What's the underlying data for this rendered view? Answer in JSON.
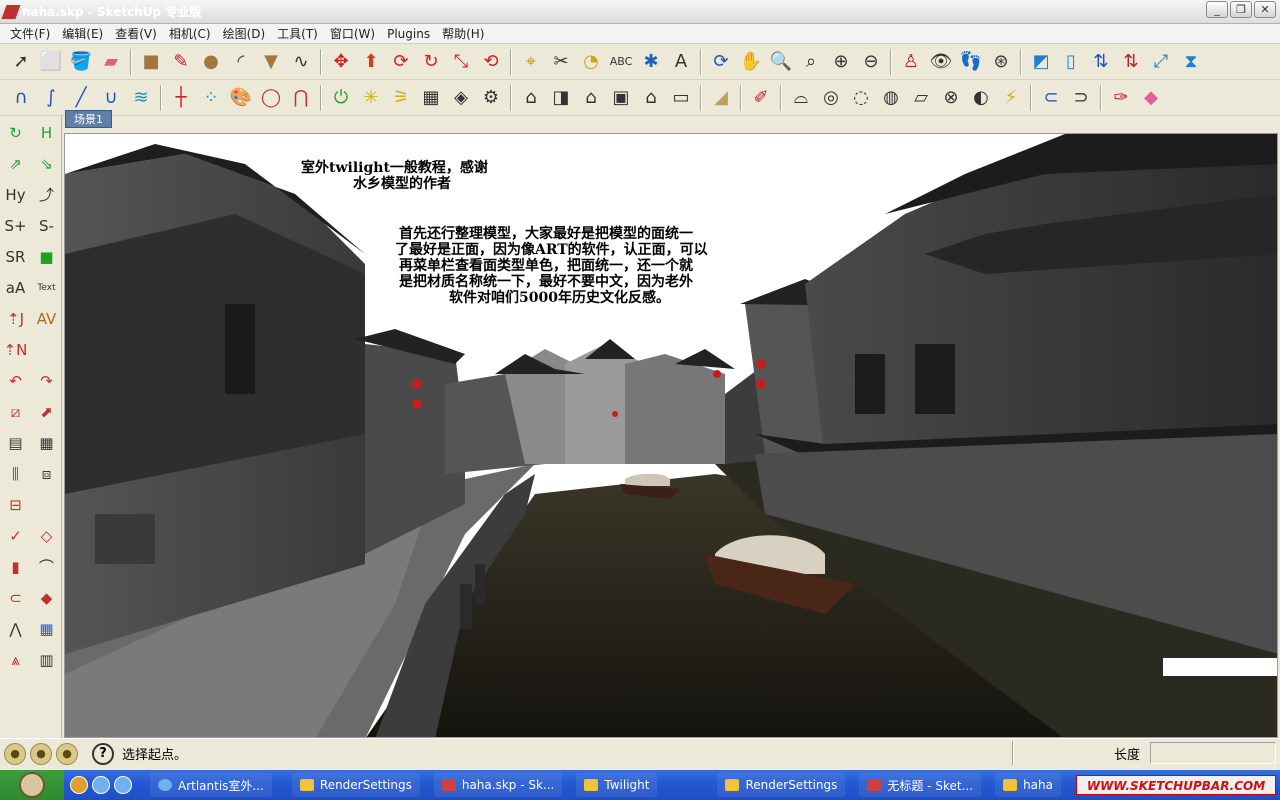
{
  "window": {
    "title": "haha.skp - SketchUp 专业版",
    "buttons": [
      "_",
      "❐",
      "✕"
    ]
  },
  "menu": [
    "文件(F)",
    "编辑(E)",
    "查看(V)",
    "相机(C)",
    "绘图(D)",
    "工具(T)",
    "窗口(W)",
    "Plugins",
    "帮助(H)"
  ],
  "scene_tab": "场景1",
  "notes": {
    "heading_line1": "室外twilight一般教程，感谢",
    "heading_line2": "水乡模型的作者",
    "body_lines": [
      "首先还行整理模型，大家最好是把模型的面统一",
      "了最好是正面，因为像ART的软件，认正面，可以",
      "再菜单栏查看面类型单色，把面统一，还一个就",
      "是把材质名称统一下，最好不要中文，因为老外",
      "软件对咱们5000年历史文化反感。"
    ]
  },
  "status": {
    "text": "选择起点。",
    "measure_label": "长度",
    "measure_value": ""
  },
  "taskbar": {
    "tasks": [
      "Artlantis室外...",
      "RenderSettings",
      "haha.skp - Sk...",
      "Twilight",
      "RenderSettings",
      "无标题 - Sket...",
      "haha"
    ],
    "watermark": "WWW.SKETCHUPBAR.COM"
  }
}
